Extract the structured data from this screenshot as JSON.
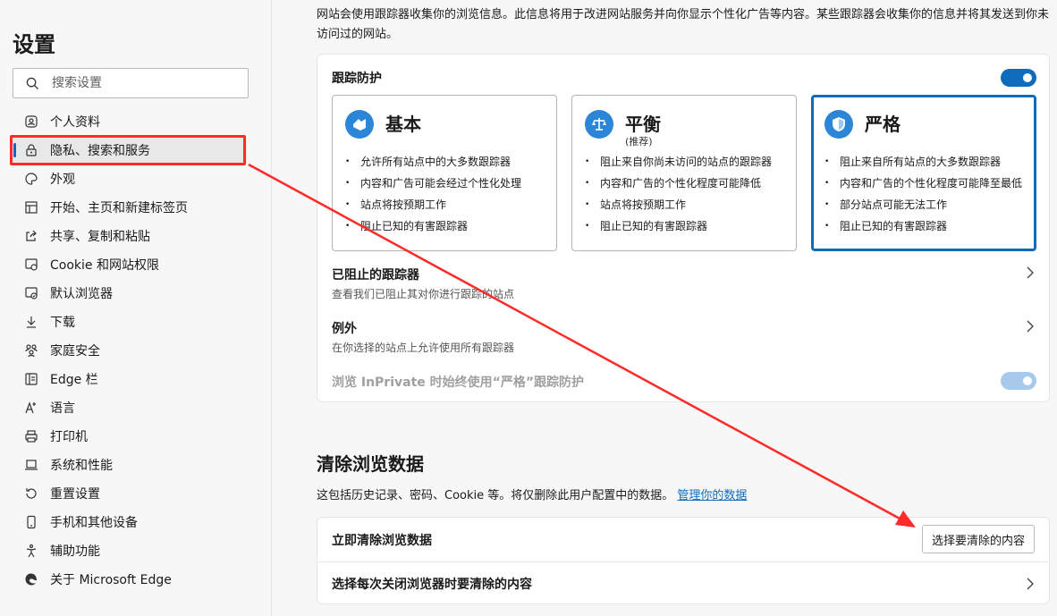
{
  "sidebar": {
    "title": "设置",
    "search_placeholder": "搜索设置",
    "items": [
      {
        "label": "个人资料",
        "icon": "profile-icon"
      },
      {
        "label": "隐私、搜索和服务",
        "icon": "lock-icon",
        "active": true
      },
      {
        "label": "外观",
        "icon": "palette-icon"
      },
      {
        "label": "开始、主页和新建标签页",
        "icon": "home-grid-icon"
      },
      {
        "label": "共享、复制和粘贴",
        "icon": "share-icon"
      },
      {
        "label": "Cookie 和网站权限",
        "icon": "cookie-icon"
      },
      {
        "label": "默认浏览器",
        "icon": "default-browser-icon"
      },
      {
        "label": "下载",
        "icon": "download-icon"
      },
      {
        "label": "家庭安全",
        "icon": "family-icon"
      },
      {
        "label": "Edge 栏",
        "icon": "edge-bar-icon"
      },
      {
        "label": "语言",
        "icon": "language-icon"
      },
      {
        "label": "打印机",
        "icon": "printer-icon"
      },
      {
        "label": "系统和性能",
        "icon": "laptop-icon"
      },
      {
        "label": "重置设置",
        "icon": "reset-icon"
      },
      {
        "label": "手机和其他设备",
        "icon": "phone-icon"
      },
      {
        "label": "辅助功能",
        "icon": "accessibility-icon"
      },
      {
        "label": "关于 Microsoft Edge",
        "icon": "edge-logo-icon"
      }
    ]
  },
  "main": {
    "intro": "网站会使用跟踪器收集你的浏览信息。此信息将用于改进网站服务并向你显示个性化广告等内容。某些跟踪器会收集你的信息并将其发送到你未访问过的网站。",
    "tracking": {
      "title": "跟踪防护",
      "enabled": true,
      "options": [
        {
          "name": "基本",
          "sub": "",
          "icon": "basic-icon",
          "bullets": [
            "允许所有站点中的大多数跟踪器",
            "内容和广告可能会经过个性化处理",
            "站点将按预期工作",
            "阻止已知的有害跟踪器"
          ]
        },
        {
          "name": "平衡",
          "sub": "(推荐)",
          "icon": "balance-icon",
          "bullets": [
            "阻止来自你尚未访问的站点的跟踪器",
            "内容和广告的个性化程度可能降低",
            "站点将按预期工作",
            "阻止已知的有害跟踪器"
          ]
        },
        {
          "name": "严格",
          "sub": "",
          "icon": "shield-icon",
          "selected": true,
          "bullets": [
            "阻止来自所有站点的大多数跟踪器",
            "内容和广告的个性化程度可能降至最低",
            "部分站点可能无法工作",
            "阻止已知的有害跟踪器"
          ]
        }
      ],
      "blocked_title": "已阻止的跟踪器",
      "blocked_desc": "查看我们已阻止其对你进行跟踪的站点",
      "exceptions_title": "例外",
      "exceptions_desc": "在你选择的站点上允许使用所有跟踪器",
      "inprivate_label": "浏览 InPrivate 时始终使用“严格”跟踪防护"
    },
    "clear": {
      "title": "清除浏览数据",
      "desc": "这包括历史记录、密码、Cookie 等。将仅删除此用户配置中的数据。",
      "link": "管理你的数据",
      "row1": "立即清除浏览数据",
      "button": "选择要清除的内容",
      "row2": "选择每次关闭浏览器时要清除的内容"
    }
  },
  "colors": {
    "accent": "#0f6cbd",
    "annotation": "#ff2a2a"
  }
}
